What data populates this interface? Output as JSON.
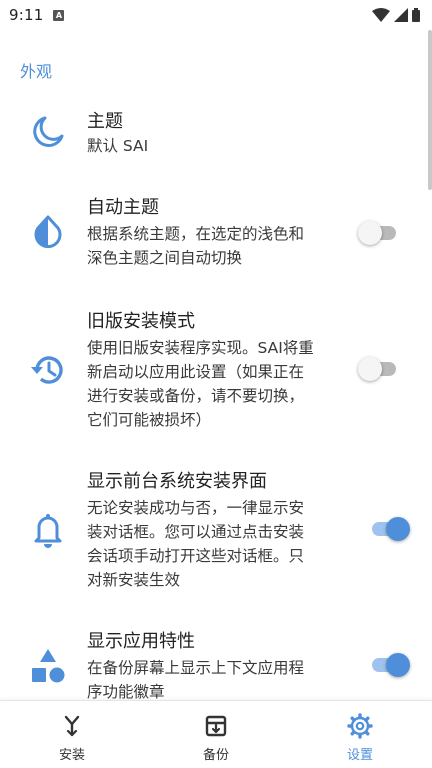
{
  "status_bar": {
    "time": "9:11",
    "notification_glyph": "A"
  },
  "section": {
    "title": "外观"
  },
  "settings": [
    {
      "icon": "moon-icon",
      "title": "主题",
      "summary": "默认 SAI"
    },
    {
      "icon": "water-drop-icon",
      "title": "自动主题",
      "summary_lines": [
        "根据系统主题，在选定的浅色和",
        "深色主题之间自动切换"
      ],
      "toggle_on": false
    },
    {
      "icon": "history-icon",
      "title": "旧版安装模式",
      "summary_lines": [
        "使用旧版安装程序实现。SAI将重",
        "新启动以应用此设置（如果正在",
        "进行安装或备份，请不要切换，",
        "它们可能被损坏）"
      ],
      "toggle_on": false
    },
    {
      "icon": "bell-icon",
      "title": "显示前台系统安装界面",
      "summary_lines": [
        "无论安装成功与否，一律显示安",
        "装对话框。您可以通过点击安装",
        "会话项手动打开这些对话框。只",
        "对新安装生效"
      ],
      "toggle_on": true
    },
    {
      "icon": "shapes-icon",
      "title": "显示应用特性",
      "summary_lines": [
        "在备份屏幕上显示上下文应用程",
        "序功能徽章"
      ],
      "toggle_on": true
    }
  ],
  "bottom_nav": [
    {
      "icon": "install-icon",
      "label": "安装",
      "active": false
    },
    {
      "icon": "backup-icon",
      "label": "备份",
      "active": false
    },
    {
      "icon": "gear-icon",
      "label": "设置",
      "active": true
    }
  ],
  "colors": {
    "accent": "#4f8fd9",
    "accent_track": "#9fc3ee",
    "switch_off_track": "#b9b9b9"
  }
}
